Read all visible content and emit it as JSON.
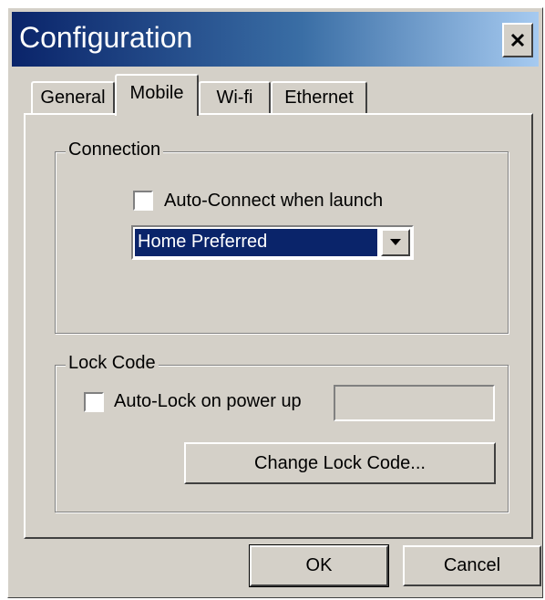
{
  "window": {
    "title": "Configuration",
    "close_icon": "close-icon"
  },
  "tabs": [
    {
      "label": "General",
      "active": false
    },
    {
      "label": "Mobile",
      "active": true
    },
    {
      "label": "Wi-fi",
      "active": false
    },
    {
      "label": "Ethernet",
      "active": false
    }
  ],
  "connection": {
    "group_label": "Connection",
    "auto_connect_label": "Auto-Connect when launch",
    "auto_connect_checked": false,
    "mode_value": "Home Preferred"
  },
  "lock_code": {
    "group_label": "Lock Code",
    "auto_lock_label": "Auto-Lock on power up",
    "auto_lock_checked": false,
    "code_value": "",
    "change_button_label": "Change Lock Code..."
  },
  "footer": {
    "ok_label": "OK",
    "cancel_label": "Cancel"
  },
  "colors": {
    "title_gradient_start": "#0a246a",
    "title_gradient_end": "#a6caf0",
    "face": "#d4d0c8",
    "selection": "#0a246a"
  }
}
